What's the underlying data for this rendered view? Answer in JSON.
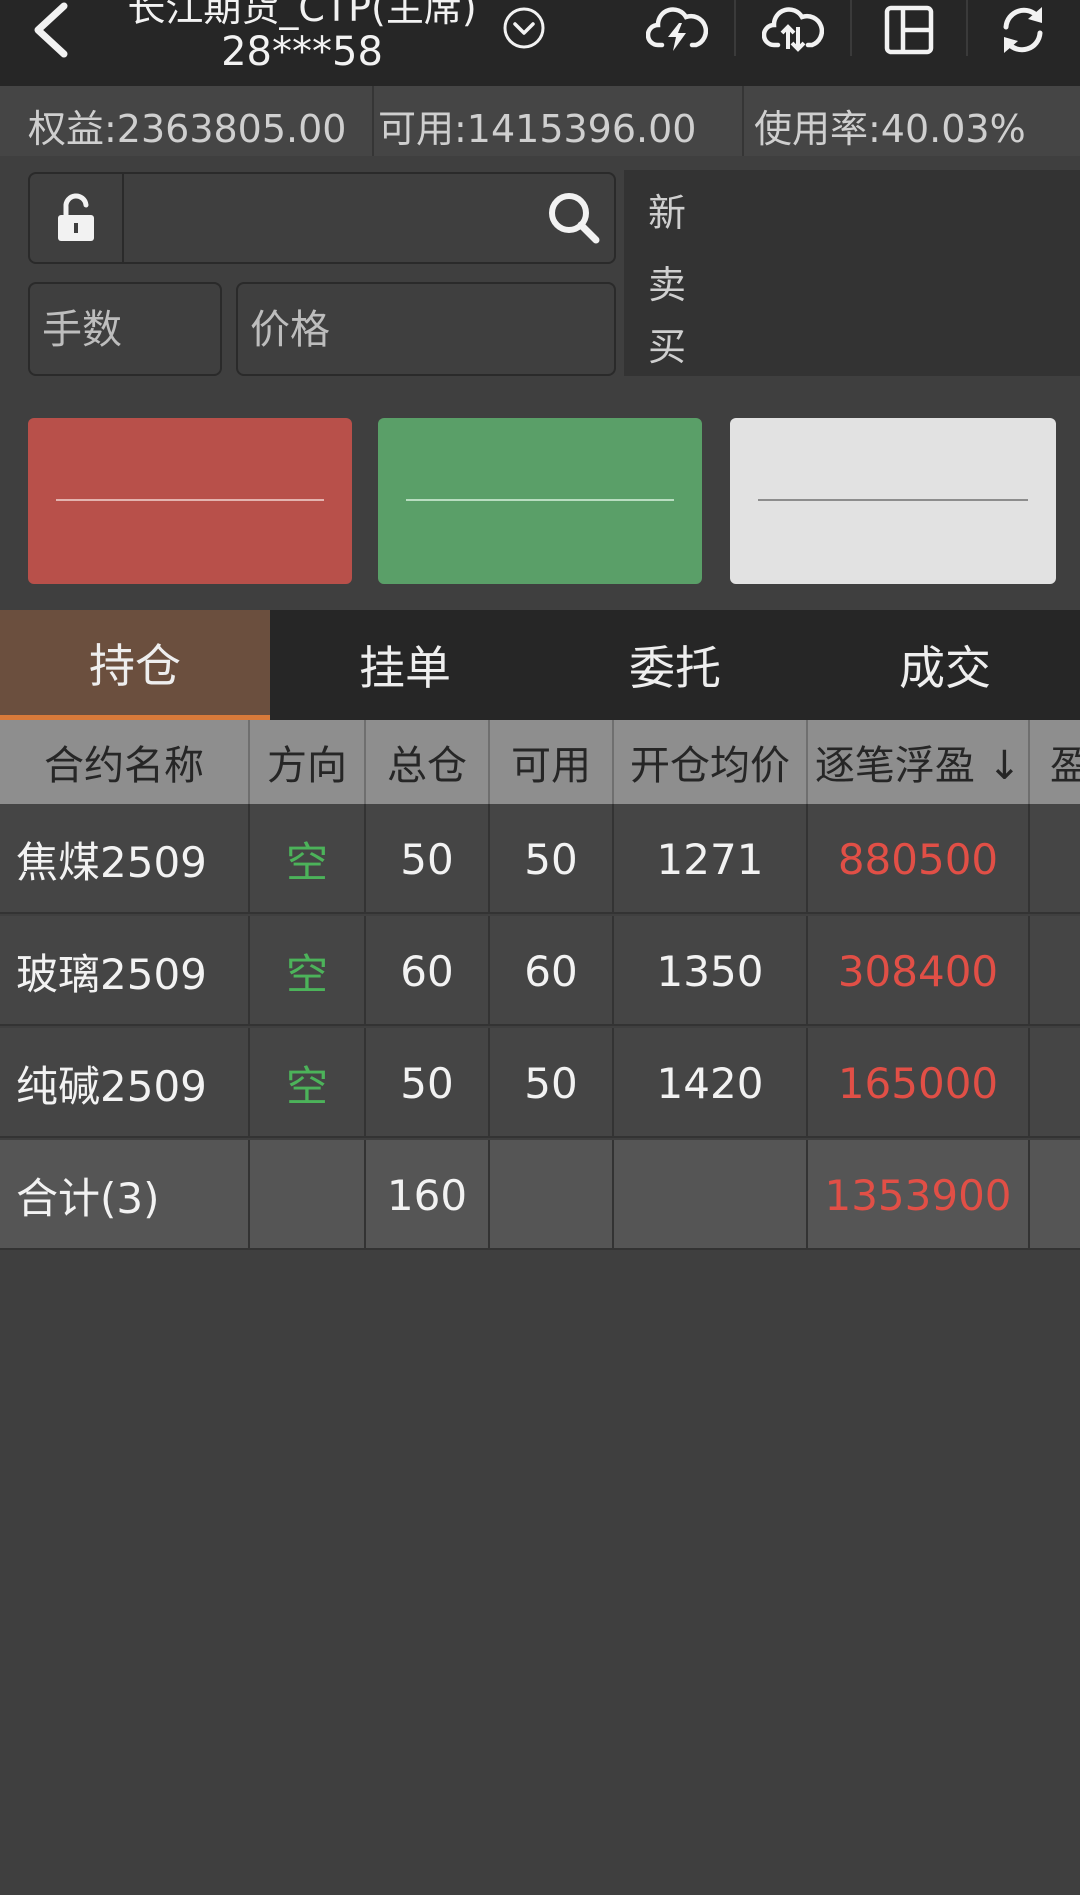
{
  "header": {
    "title_line1": "长江期货_CTP(主席)",
    "title_line2": "28***58",
    "icons": [
      "back-icon",
      "dropdown-icon",
      "cloud-lightning-icon",
      "cloud-sync-icon",
      "layout-icon",
      "refresh-icon"
    ]
  },
  "account": {
    "equity": "权益:2363805.00",
    "available": "可用:1415396.00",
    "usage": "使用率:40.03%"
  },
  "order": {
    "search_value": "",
    "qty_placeholder": "手数",
    "price_placeholder": "价格",
    "quote_labels": [
      "新",
      "卖",
      "买"
    ]
  },
  "tabs": [
    "持仓",
    "挂单",
    "委托",
    "成交"
  ],
  "positions": {
    "headers": [
      "合约名称",
      "方向",
      "总仓",
      "可用",
      "开仓均价",
      "逐笔浮盈 ↓",
      "盈"
    ],
    "rows": [
      {
        "name": "焦煤2509",
        "dir": "空",
        "total": "50",
        "avail": "50",
        "avg": "1271",
        "pnl": "880500"
      },
      {
        "name": "玻璃2509",
        "dir": "空",
        "total": "60",
        "avail": "60",
        "avg": "1350",
        "pnl": "308400"
      },
      {
        "name": "纯碱2509",
        "dir": "空",
        "total": "50",
        "avail": "50",
        "avg": "1420",
        "pnl": "165000"
      }
    ],
    "total": {
      "name": "合计(3)",
      "total": "160",
      "pnl": "1353900"
    }
  },
  "colors": {
    "buy": "#b8504a",
    "sell": "#5a9f68",
    "close": "#e2e2e2",
    "active_tab": "#6b4f3e",
    "short_dir": "#4cb35a",
    "profit": "#e14f46"
  }
}
